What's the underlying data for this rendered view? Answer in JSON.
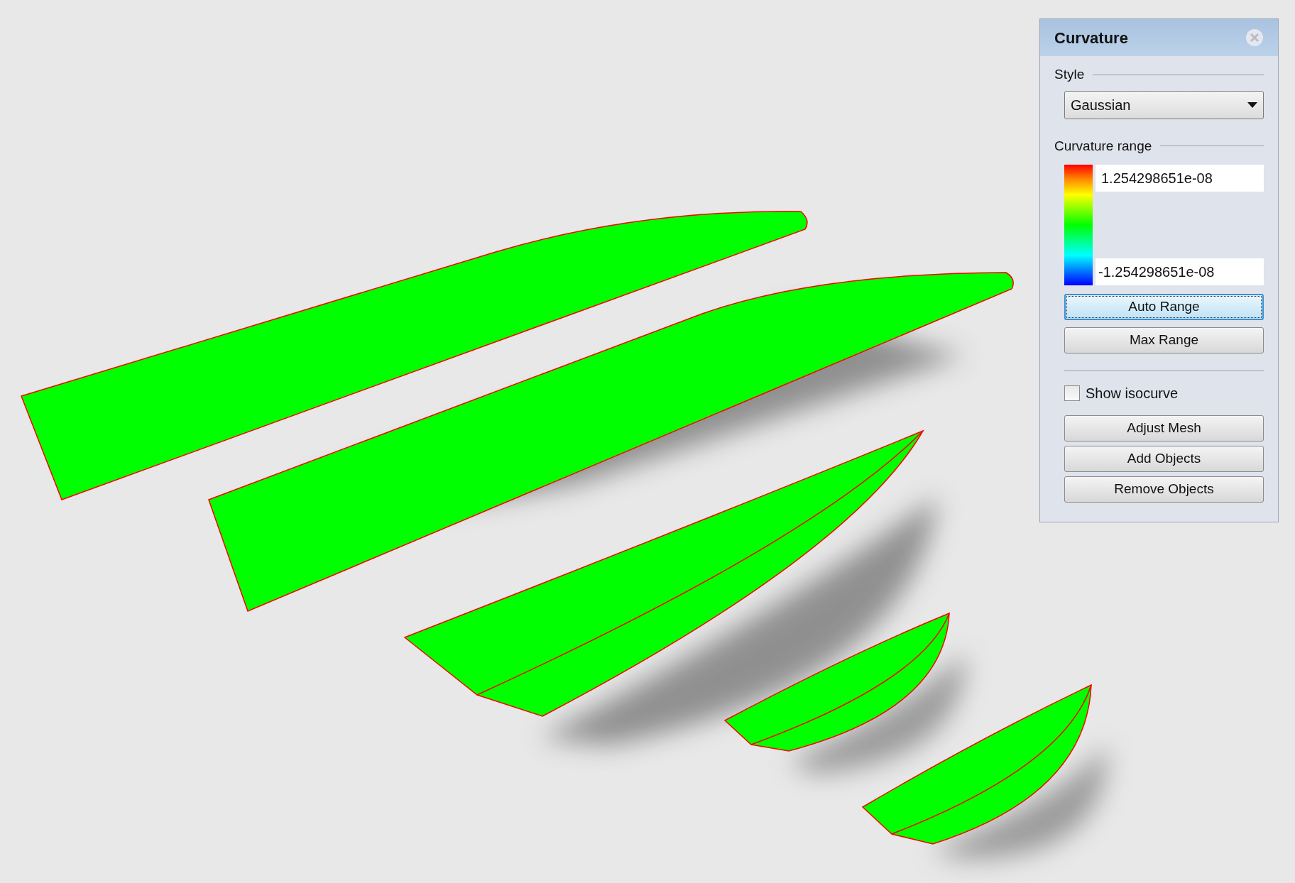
{
  "panel": {
    "title": "Curvature",
    "style_label": "Style",
    "style_value": "Gaussian",
    "range_label": "Curvature range",
    "range_max": "1.254298651e-08",
    "range_min": "-1.254298651e-08",
    "range_buttons": [
      {
        "label": "Auto Range",
        "focused": true
      },
      {
        "label": "Max Range",
        "focused": false
      }
    ],
    "show_isocurve": {
      "label": "Show isocurve",
      "checked": false
    },
    "buttons": [
      {
        "label": "Adjust Mesh",
        "focused": false
      },
      {
        "label": "Add Objects",
        "focused": false
      },
      {
        "label": "Remove Objects",
        "focused": false
      }
    ]
  }
}
